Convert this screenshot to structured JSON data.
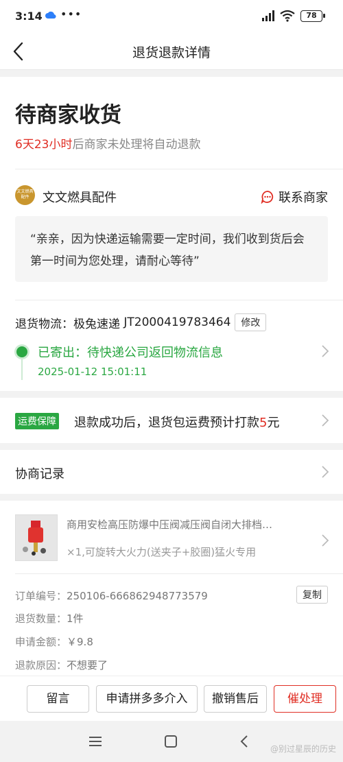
{
  "status_bar": {
    "time": "3:14",
    "battery": "78"
  },
  "nav": {
    "title": "退货退款详情"
  },
  "status": {
    "title": "待商家收货",
    "countdown": "6天23小时",
    "countdown_suffix": "后商家未处理将自动退款"
  },
  "seller": {
    "logo_text": "文文燃具配件",
    "name": "文文燃具配件",
    "contact_label": "联系商家",
    "message": "“亲亲，因为快递运输需要一定时间，我们收到货后会第一时间为您处理，请耐心等待”"
  },
  "logistics": {
    "label": "退货物流：",
    "carrier": "极兔速递",
    "tracking_no": "JT2000419783464",
    "edit_label": "修改",
    "track_status": "已寄出：待快递公司返回物流信息",
    "track_time": "2025-01-12 15:01:11"
  },
  "shipping_guarantee": {
    "badge": "运费保障",
    "text_before": "退款成功后，退货包运费预计打款",
    "amount": "5",
    "text_after": "元"
  },
  "negotiation": {
    "title": "协商记录"
  },
  "product": {
    "name": "商用安检高压防爆中压阀减压阀自闭大排档…",
    "spec": "×1,可旋转大火力(送夹子+胶圈)猛火专用"
  },
  "order_info": {
    "order_no_label": "订单编号：",
    "order_no": "250106-666862948773579",
    "copy_label": "复制",
    "qty_label": "退货数量：",
    "qty": "1件",
    "amount_label": "申请金额：",
    "amount": "￥9.8",
    "reason_label": "退款原因：",
    "reason": "不想要了"
  },
  "actions": {
    "message": "留言",
    "platform": "申请拼多多介入",
    "cancel": "撤销售后",
    "urge": "催处理"
  },
  "watermark": "@别过星辰的历史"
}
